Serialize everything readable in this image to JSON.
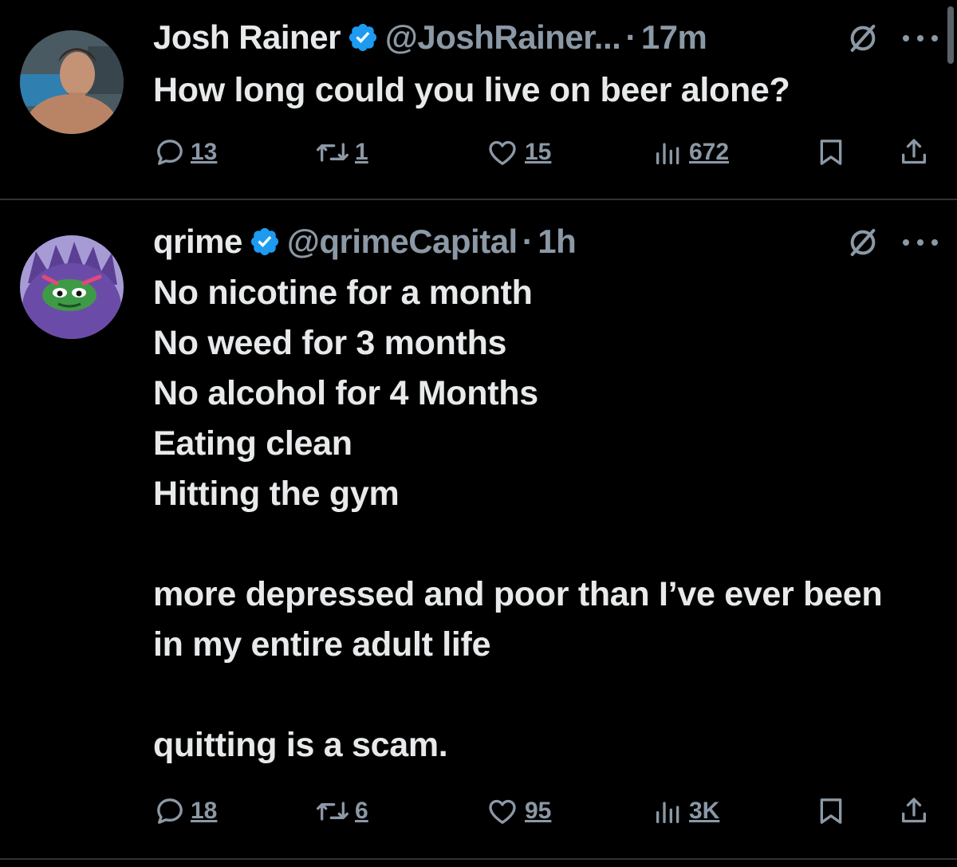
{
  "tweets": [
    {
      "display_name": "Josh Rainer",
      "handle": "@JoshRainer...",
      "separator": "·",
      "time": "17m",
      "text": "How long could you live on beer alone?",
      "replies": "13",
      "reposts": "1",
      "likes": "15",
      "views": "672"
    },
    {
      "display_name": "qrime",
      "handle": "@qrimeCapital",
      "separator": "·",
      "time": "1h",
      "text": "No nicotine for a month\nNo weed for 3 months\nNo alcohol for 4 Months\nEating clean\nHitting the gym\n\nmore depressed and poor than I’ve ever been in my entire adult life\n\nquitting is a scam.",
      "replies": "18",
      "reposts": "6",
      "likes": "95",
      "views": "3K"
    }
  ],
  "icons": {
    "verified": "verified-badge-icon",
    "grok": "grok-icon",
    "more": "more-options-icon",
    "reply": "reply-icon",
    "repost": "repost-icon",
    "like": "like-icon",
    "views": "views-icon",
    "bookmark": "bookmark-icon",
    "share": "share-icon"
  },
  "colors": {
    "background": "#000000",
    "text": "#e7e9ea",
    "secondary": "#8b98a5",
    "verified_blue": "#1d9bf0",
    "divider": "#2f3336"
  }
}
